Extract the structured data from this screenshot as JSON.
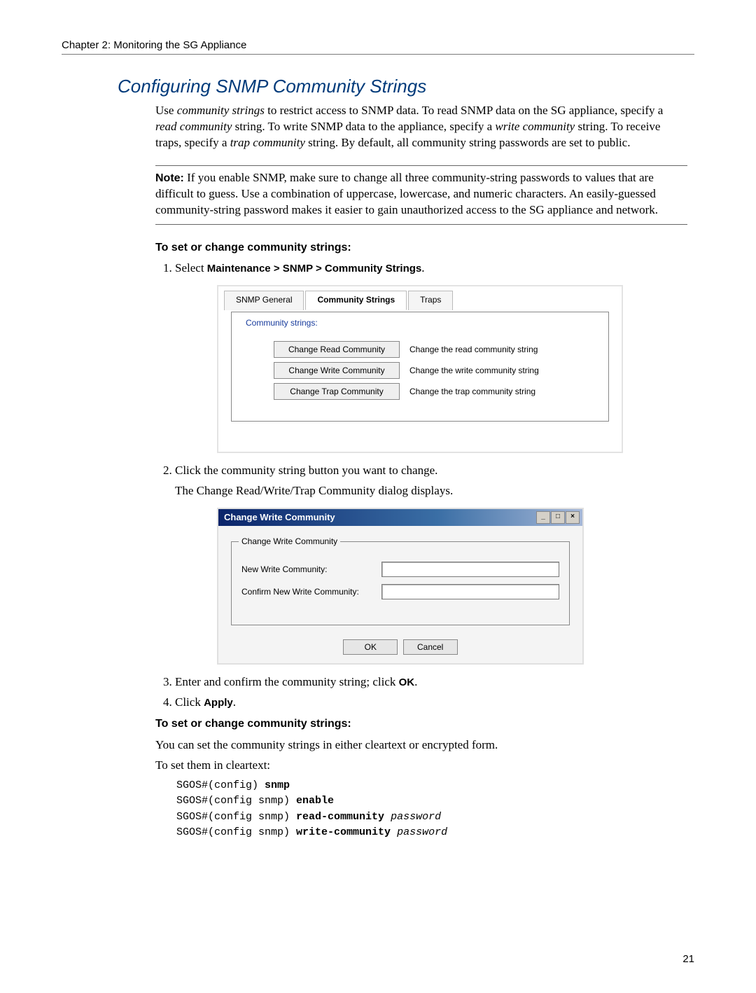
{
  "header": {
    "chapter": "Chapter 2:  Monitoring the SG Appliance"
  },
  "title": "Configuring SNMP Community Strings",
  "intro": {
    "p1a": "Use ",
    "p1b": "community strings",
    "p1c": " to restrict access to SNMP data. To read SNMP data on the SG appliance, specify a ",
    "p1d": "read community",
    "p1e": " string. To write SNMP data to the appliance, specify a ",
    "p1f": "write community",
    "p1g": " string. To receive traps, specify a ",
    "p1h": "trap community",
    "p1i": " string. By default, all community string passwords are set to public."
  },
  "note": {
    "label": "Note:",
    "text": "If you enable SNMP, make sure to change all three community-string passwords to values that are difficult to guess. Use a combination of uppercase, lowercase, and numeric characters. An easily-guessed community-string password makes it easier to gain unauthorized access to the SG appliance and network."
  },
  "subhead1": "To set or change community strings:",
  "step1": {
    "pre": "Select ",
    "bold": "Maintenance > SNMP > Community Strings",
    "post": "."
  },
  "shot1": {
    "tabs": [
      "SNMP General",
      "Community Strings",
      "Traps"
    ],
    "legend": "Community strings:",
    "rows": [
      {
        "btn": "Change Read Community",
        "desc": "Change the read community string"
      },
      {
        "btn": "Change Write Community",
        "desc": "Change the write community string"
      },
      {
        "btn": "Change Trap Community",
        "desc": "Change the trap community string"
      }
    ]
  },
  "step2": {
    "line1": "Click the community string button you want to change.",
    "line2": "The Change Read/Write/Trap Community dialog displays."
  },
  "dialog": {
    "title": "Change Write Community",
    "legend": "Change Write Community",
    "label1": "New Write Community:",
    "label2": "Confirm New Write Community:",
    "ok": "OK",
    "cancel": "Cancel",
    "win": {
      "min": "_",
      "max": "□",
      "close": "×"
    }
  },
  "step3": {
    "pre": "Enter and confirm the community string; click ",
    "bold": "OK",
    "post": "."
  },
  "step4": {
    "pre": "Click ",
    "bold": "Apply",
    "post": "."
  },
  "subhead2": "To set or change community strings:",
  "after": {
    "p1": "You can set the community strings in either cleartext or encrypted form.",
    "p2": "To set them in cleartext:"
  },
  "cli": {
    "l1a": "SGOS#(config) ",
    "l1b": "snmp",
    "l2a": "SGOS#(config snmp) ",
    "l2b": "enable",
    "l3a": "SGOS#(config snmp) ",
    "l3b": "read-community ",
    "l3c": "password",
    "l4a": "SGOS#(config snmp) ",
    "l4b": "write-community ",
    "l4c": "password"
  },
  "page_number": "21"
}
